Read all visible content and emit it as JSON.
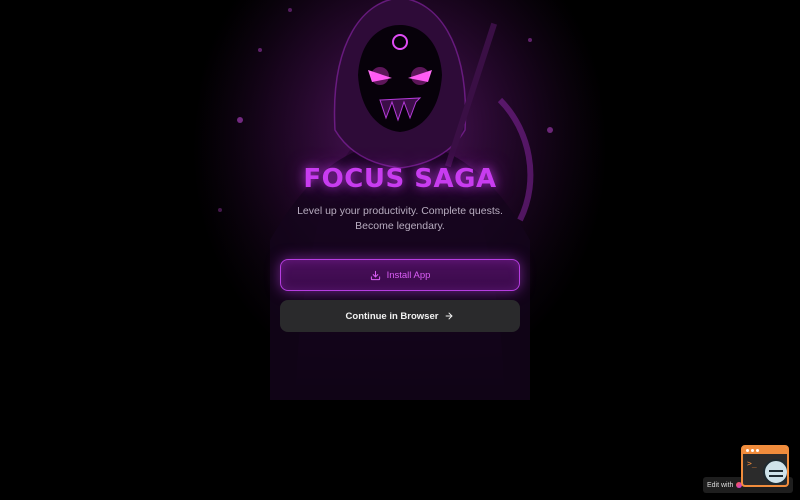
{
  "app": {
    "title": "FOCUS SAGA",
    "tagline": "Level up your productivity. Complete quests. Become legendary."
  },
  "actions": {
    "install_label": "Install App",
    "install_icon": "download-icon",
    "browser_label": "Continue in Browser",
    "browser_icon": "arrow-right-icon"
  },
  "badge": {
    "prefix": "Edit with",
    "brand": "Lovable"
  },
  "theme": {
    "accent": "#c83cf0",
    "install_border": "#b63de0",
    "secondary_button": "#2a2a2c",
    "background": "#000000"
  }
}
